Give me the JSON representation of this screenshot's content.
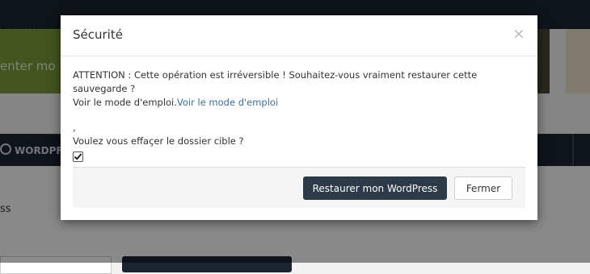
{
  "background": {
    "banner_text": "enter mo",
    "nav_item_label": "WORDPF",
    "content_text": "ss"
  },
  "modal": {
    "title": "Sécurité",
    "close_symbol": "×",
    "warning_text": "ATTENTION : Cette opération est irréversible ! Souhaitez-vous vraiment restaurer cette sauvegarde ?",
    "manual_prefix": "Voir le mode d'emploi.",
    "manual_link": "Voir le mode d'emploi",
    "comma": ",",
    "question": "Voulez vous effaçer le dossier cible ?",
    "checkbox_checked": true,
    "restore_button": "Restaurer mon WordPress",
    "close_button": "Fermer"
  }
}
